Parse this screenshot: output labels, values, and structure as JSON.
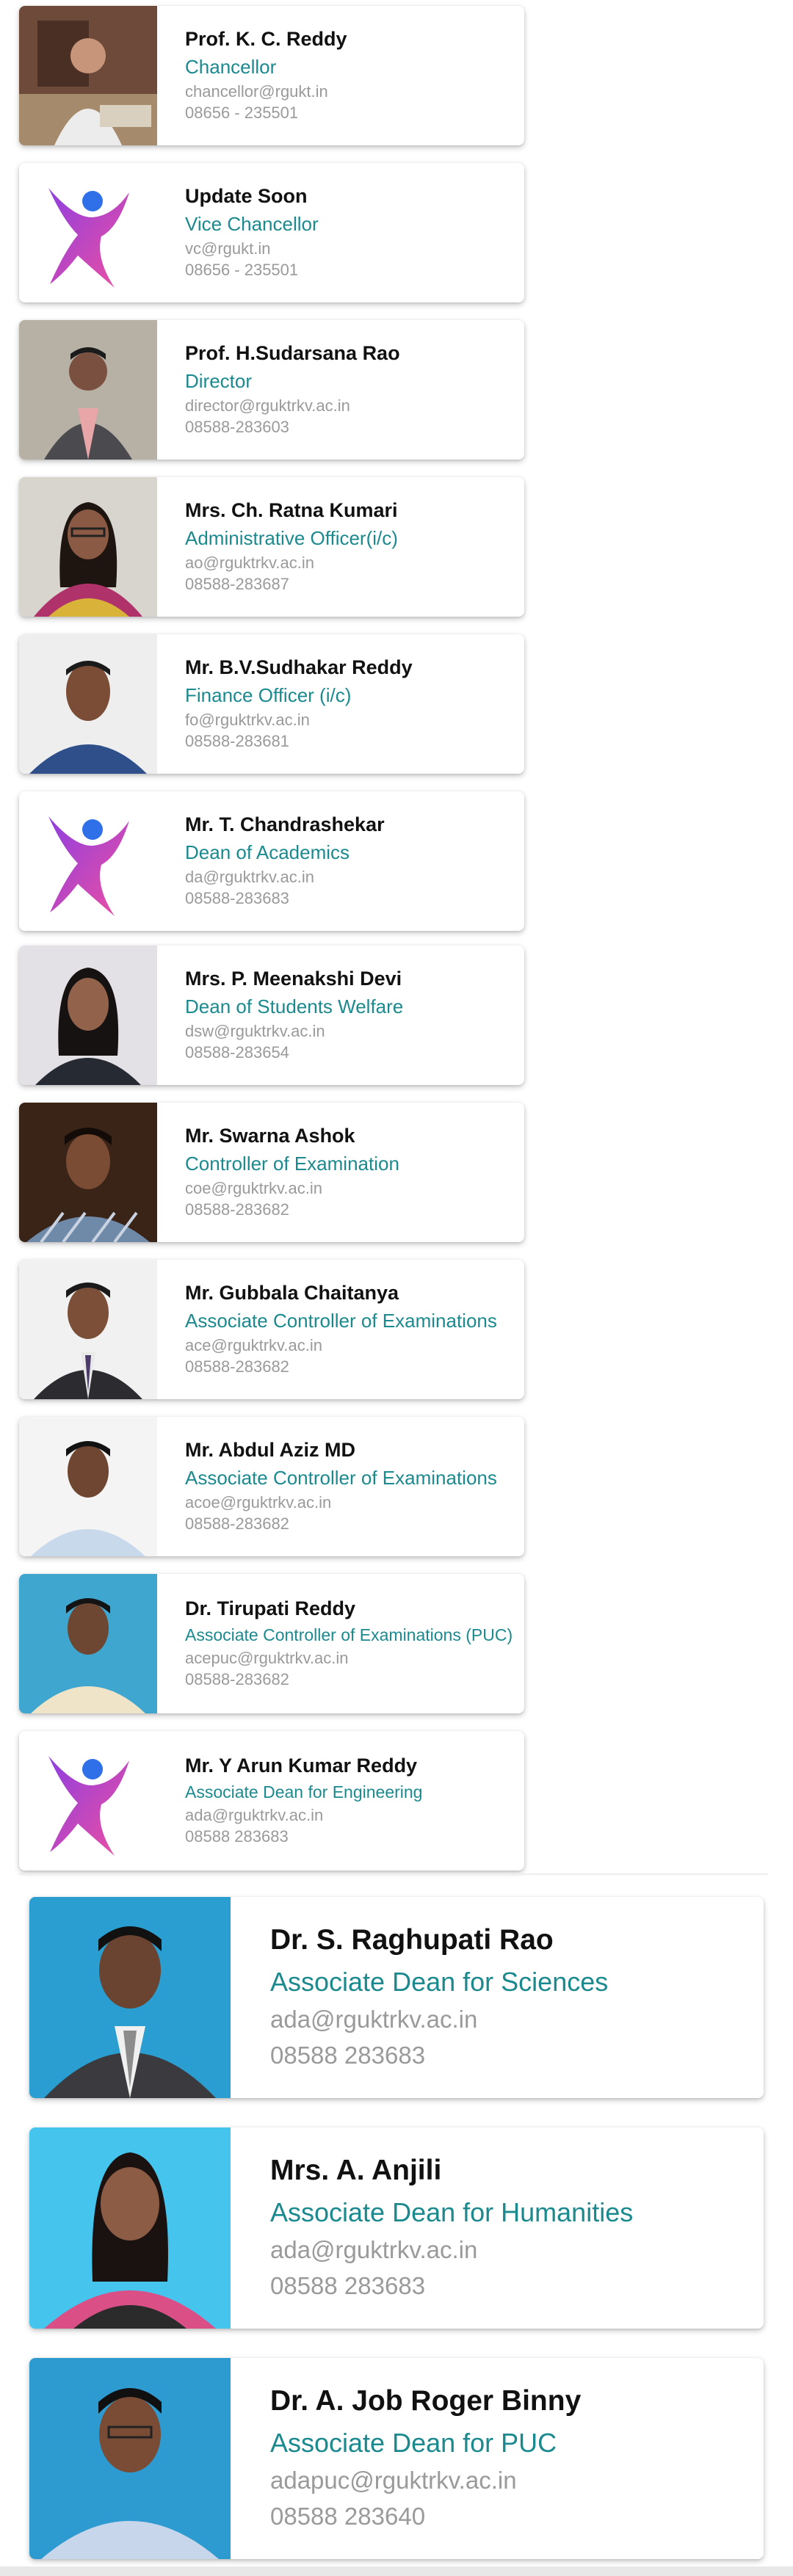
{
  "staff": [
    {
      "name": "Prof. K. C. Reddy",
      "role": "Chancellor",
      "email": "chancellor@rgukt.in",
      "phone": "08656 - 235501"
    },
    {
      "name": "Update Soon",
      "role": "Vice Chancellor",
      "email": "vc@rgukt.in",
      "phone": "08656 - 235501"
    },
    {
      "name": "Prof. H.Sudarsana Rao",
      "role": "Director",
      "email": "director@rguktrkv.ac.in",
      "phone": "08588-283603"
    },
    {
      "name": "Mrs. Ch. Ratna Kumari",
      "role": "Administrative Officer(i/c)",
      "email": "ao@rguktrkv.ac.in",
      "phone": "08588-283687"
    },
    {
      "name": "Mr. B.V.Sudhakar Reddy",
      "role": "Finance Officer (i/c)",
      "email": "fo@rguktrkv.ac.in",
      "phone": "08588-283681"
    },
    {
      "name": "Mr. T. Chandrashekar",
      "role": "Dean of Academics",
      "email": "da@rguktrkv.ac.in",
      "phone": "08588-283683"
    },
    {
      "name": "Mrs. P. Meenakshi Devi",
      "role": "Dean of Students Welfare",
      "email": "dsw@rguktrkv.ac.in",
      "phone": "08588-283654"
    },
    {
      "name": "Mr. Swarna Ashok",
      "role": "Controller of Examination",
      "email": "coe@rguktrkv.ac.in",
      "phone": "08588-283682"
    },
    {
      "name": "Mr. Gubbala Chaitanya",
      "role": "Associate Controller of Examinations",
      "email": "ace@rguktrkv.ac.in",
      "phone": "08588-283682"
    },
    {
      "name": "Mr. Abdul Aziz MD",
      "role": "Associate Controller of Examinations",
      "email": "acoe@rguktrkv.ac.in",
      "phone": "08588-283682"
    },
    {
      "name": "Dr. Tirupati Reddy",
      "role": "Associate Controller of Examinations (PUC)",
      "email": "acepuc@rguktrkv.ac.in",
      "phone": "08588-283682"
    },
    {
      "name": "Mr. Y Arun Kumar Reddy",
      "role": "Associate Dean for Engineering",
      "email": "ada@rguktrkv.ac.in",
      "phone": "08588 283683"
    },
    {
      "name": "Dr. S. Raghupati Rao",
      "role": "Associate Dean for Sciences",
      "email": "ada@rguktrkv.ac.in",
      "phone": "08588 283683"
    },
    {
      "name": "Mrs. A. Anjili",
      "role": "Associate Dean for Humanities",
      "email": "ada@rguktrkv.ac.in",
      "phone": "08588 283683"
    },
    {
      "name": "Dr. A. Job Roger Binny",
      "role": "Associate Dean for PUC",
      "email": "adapuc@rguktrkv.ac.in",
      "phone": "08588 283640"
    }
  ],
  "colors": {
    "name": "#111111",
    "role": "#1b8a8f",
    "contact": "#9a9a9a",
    "logo_gradient_start": "#8e3fe0",
    "logo_gradient_end": "#f04fa0",
    "logo_head": "#2f6fe8"
  },
  "icons": {
    "placeholder": "person-logo-icon",
    "photo": "person-photo"
  }
}
